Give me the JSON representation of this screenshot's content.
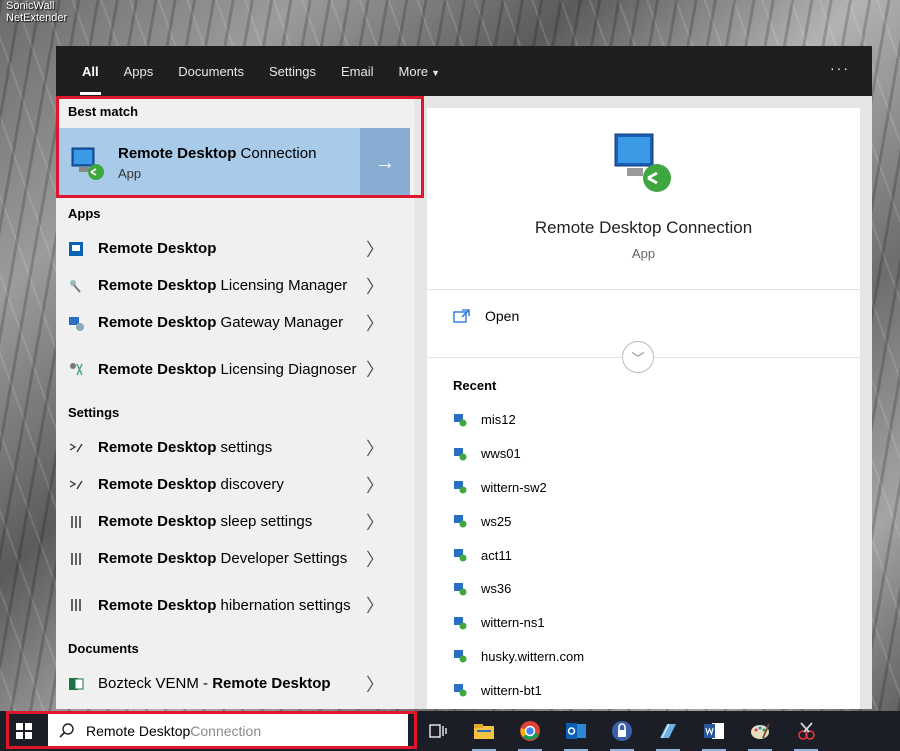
{
  "desktop": {
    "icon_label": "SonicWall NetExtender"
  },
  "filters": {
    "tabs": [
      "All",
      "Apps",
      "Documents",
      "Settings",
      "Email",
      "More"
    ],
    "more_icon": "ellipsis-icon"
  },
  "best_match": {
    "header": "Best match",
    "title_bold": "Remote Desktop",
    "title_rest": " Connection",
    "subtitle": "App"
  },
  "apps": {
    "header": "Apps",
    "items": [
      {
        "bold": "Remote Desktop",
        "rest": ""
      },
      {
        "bold": "Remote Desktop",
        "rest": " Licensing Manager"
      },
      {
        "bold": "Remote Desktop",
        "rest": " Gateway Manager"
      },
      {
        "bold": "Remote Desktop",
        "rest": " Licensing Diagnoser"
      }
    ]
  },
  "settings": {
    "header": "Settings",
    "items": [
      {
        "bold": "Remote Desktop",
        "rest": " settings"
      },
      {
        "bold": "Remote Desktop",
        "rest": " discovery"
      },
      {
        "bold": "Remote Desktop",
        "rest": " sleep settings"
      },
      {
        "bold": "Remote Desktop",
        "rest": " Developer Settings"
      },
      {
        "bold": "Remote Desktop",
        "rest": " hibernation settings"
      }
    ]
  },
  "documents": {
    "header": "Documents",
    "items": [
      {
        "prefix": "Bozteck VENM - ",
        "bold": "Remote Desktop"
      }
    ]
  },
  "preview": {
    "title": "Remote Desktop Connection",
    "subtitle": "App",
    "open_label": "Open",
    "recent_header": "Recent",
    "recent": [
      "mis12",
      "wws01",
      "wittern-sw2",
      "ws25",
      "act11",
      "ws36",
      "wittern-ns1",
      "husky.wittern.com",
      "wittern-bt1"
    ]
  },
  "taskbar": {
    "search_typed": "Remote Desktop",
    "search_suggestion": " Connection"
  },
  "colors": {
    "highlight": "#e0172c",
    "best_bg": "#a9cbea",
    "accent": "#0078d7"
  }
}
